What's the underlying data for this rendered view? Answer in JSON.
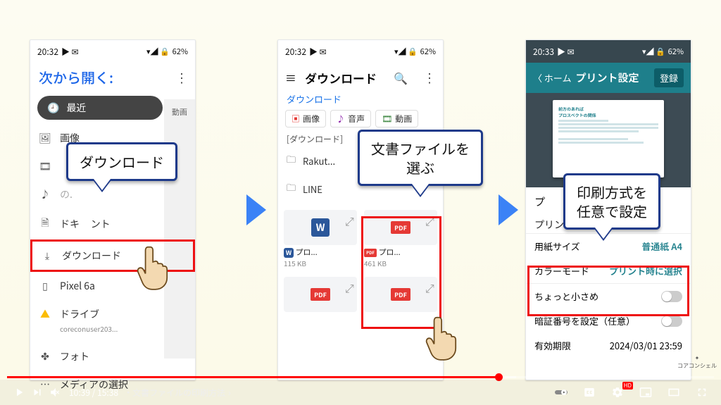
{
  "status": {
    "time1": "20:32",
    "time2": "20:32",
    "time3": "20:33",
    "battery": "62%"
  },
  "p1": {
    "title": "次から開く:",
    "recent": "最近",
    "items_pre": [
      "画像"
    ],
    "download": "ダウンロード",
    "items_post": [
      "ド",
      "Pixel 6a"
    ],
    "drive": "ドライブ",
    "drive_sub": "coreconuser203...",
    "photos": "フォト",
    "media": "メディアの選択",
    "doc_partial": "ドキ",
    "doc_suffix": "ント",
    "ext": "動画"
  },
  "callouts": {
    "c1": "ダウンロード",
    "c2a": "文書ファイルを",
    "c2b": "選ぶ",
    "c3a": "印刷方式を",
    "c3b": "任意で設定"
  },
  "p2": {
    "title": "ダウンロード",
    "sub": "ダウンロード",
    "tabs": {
      "img": "画像",
      "aud": "音声",
      "vid": "動画"
    },
    "section": "[ダウンロード]",
    "folders": [
      "Rakut...",
      "LINE"
    ],
    "files": [
      {
        "name": "プロ...",
        "size": "115 KB",
        "type": "w"
      },
      {
        "name": "プロ...",
        "size": "461 KB",
        "type": "pdf"
      }
    ]
  },
  "p3": {
    "back": "ホーム",
    "title": "プリント設定",
    "register": "登録",
    "proc_partial": "プ",
    "fee": "プリント料金",
    "paper_l": "用紙サイズ",
    "paper_v": "普通紙 A4",
    "color_l": "カラーモード",
    "color_v": "プリント時に選択",
    "small": "ちょっと小さめ",
    "pin": "暗証番号を設定（任意）",
    "expire_l": "有効期限",
    "expire_v": "2024/03/01 23:59"
  },
  "player": {
    "current": "10:39",
    "total": "15:38",
    "chapter": "・文書ファイルの印刷方法",
    "hd": "HD"
  },
  "brand": "コアコンシェル"
}
